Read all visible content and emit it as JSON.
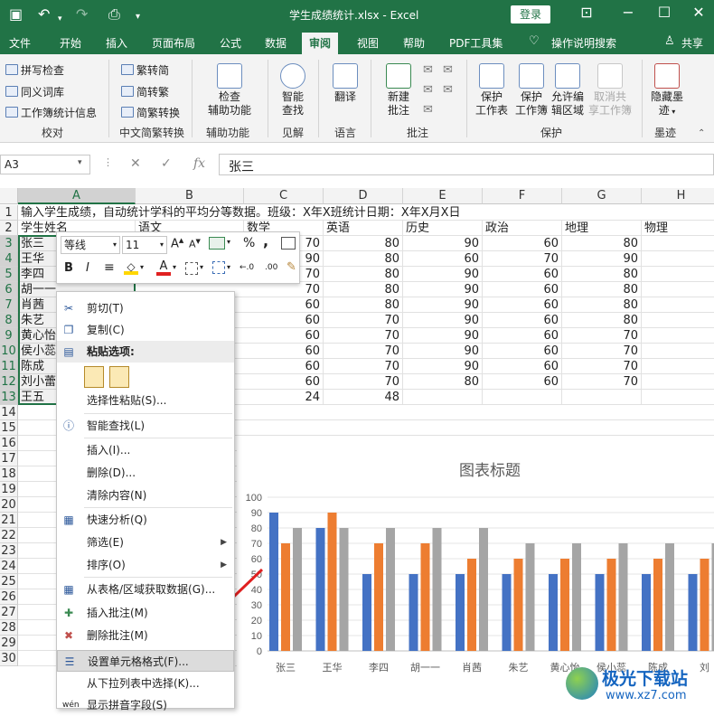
{
  "window": {
    "title": "学生成绩统计.xlsx  -  Excel",
    "login": "登录"
  },
  "menu_tabs": [
    "文件",
    "开始",
    "插入",
    "页面布局",
    "公式",
    "数据",
    "审阅",
    "视图",
    "帮助",
    "PDF工具集",
    "操作说明搜索",
    "共享"
  ],
  "active_tab": "审阅",
  "ribbon": {
    "proofing": {
      "spell": "拼写检查",
      "thesaurus": "同义词库",
      "stats": "工作簿统计信息",
      "group": "校对"
    },
    "chinese": {
      "to_trad": "繁转简",
      "to_simp": "简转繁",
      "convert": "简繁转换",
      "group": "中文简繁转换"
    },
    "access": {
      "check_line1": "检查",
      "check_line2": "辅助功能",
      "group": "辅助功能"
    },
    "insights": {
      "smart_line1": "智能",
      "smart_line2": "查找",
      "group": "见解"
    },
    "language": {
      "translate": "翻译",
      "group": "语言"
    },
    "comments": {
      "new_line1": "新建",
      "new_line2": "批注",
      "group": "批注"
    },
    "protect": {
      "sheet_line1": "保护",
      "sheet_line2": "工作表",
      "book_line1": "保护",
      "book_line2": "工作簿",
      "range_line1": "允许编",
      "range_line2": "辑区域",
      "unshare_line1": "取消共",
      "unshare_line2": "享工作簿",
      "group": "保护"
    },
    "ink": {
      "hide_line1": "隐藏墨",
      "hide_line2": "迹",
      "group": "墨迹"
    }
  },
  "formula_bar": {
    "name_box": "A3",
    "cancel": "✕",
    "enter": "✓",
    "fx": "fx",
    "content": "张三"
  },
  "sheet": {
    "columns": [
      "A",
      "B",
      "C",
      "D",
      "E",
      "F",
      "G",
      "H"
    ],
    "rows": [
      "1",
      "2",
      "3",
      "4",
      "5",
      "6",
      "7",
      "8",
      "9",
      "10",
      "11",
      "12",
      "13",
      "14",
      "15",
      "16",
      "17",
      "18",
      "19",
      "20",
      "21",
      "22",
      "23",
      "24",
      "25",
      "26",
      "27",
      "28",
      "29",
      "30"
    ],
    "row1_text": "输入学生成绩，自动统计学科的平均分等数据。班级：X年X班统计日期：X年X月X日",
    "headers": {
      "a": "学生姓名",
      "b": "语文",
      "c": "数学",
      "d": "英语",
      "e": "历史",
      "f": "政治",
      "g": "地理",
      "h": "物理"
    },
    "names": [
      "张三",
      "王华",
      "李四",
      "胡一一",
      "肖茜",
      "朱艺",
      "黄心怡",
      "侯小蕊",
      "陈成",
      "刘小蕾",
      "王五"
    ],
    "math": [
      "70",
      "90",
      "70",
      "70",
      "60",
      "60",
      "60",
      "60",
      "60",
      "60",
      "24"
    ],
    "english": [
      "80",
      "80",
      "80",
      "80",
      "80",
      "70",
      "70",
      "70",
      "70",
      "70",
      "48"
    ],
    "history": [
      "90",
      "60",
      "90",
      "90",
      "90",
      "90",
      "90",
      "90",
      "90",
      "80",
      ""
    ],
    "politics": [
      "60",
      "70",
      "60",
      "60",
      "60",
      "60",
      "60",
      "60",
      "60",
      "60",
      ""
    ],
    "geography": [
      "80",
      "90",
      "80",
      "80",
      "80",
      "80",
      "70",
      "70",
      "70",
      "70",
      ""
    ]
  },
  "mini_toolbar": {
    "font": "等线",
    "size": "11",
    "grow": "A",
    "shrink": "A",
    "percent": "%",
    "comma": ",",
    "bold": "B",
    "italic": "I",
    "font_color_letter": "A",
    "dec_inc": "←.0",
    "dec_dec": ".00"
  },
  "context_menu": {
    "cut": "剪切(T)",
    "copy": "复制(C)",
    "paste_options": "粘贴选项:",
    "paste_special": "选择性粘贴(S)...",
    "smart_lookup": "智能查找(L)",
    "insert": "插入(I)...",
    "delete": "删除(D)...",
    "clear": "清除内容(N)",
    "quick_analysis": "快速分析(Q)",
    "filter": "筛选(E)",
    "sort": "排序(O)",
    "from_table": "从表格/区域获取数据(G)...",
    "insert_comment": "插入批注(M)",
    "delete_comment": "删除批注(M)",
    "format_cells": "设置单元格格式(F)...",
    "pick_list": "从下拉列表中选择(K)...",
    "phonetic": "显示拼音字段(S)",
    "phonetic_icon": "wén"
  },
  "chart_data": {
    "type": "bar",
    "title": "图表标题",
    "categories": [
      "张三",
      "王华",
      "李四",
      "胡一一",
      "肖茜",
      "朱艺",
      "黄心怡",
      "侯小蕊",
      "陈成",
      "刘"
    ],
    "ylim": [
      0,
      100
    ],
    "yticks": [
      "0",
      "10",
      "20",
      "30",
      "40",
      "50",
      "60",
      "70",
      "80",
      "90",
      "100"
    ],
    "series": [
      {
        "values": [
          90,
          80,
          50,
          50,
          50,
          50,
          50,
          50,
          50,
          50
        ],
        "color": "#4472c4"
      },
      {
        "values": [
          70,
          90,
          70,
          70,
          60,
          60,
          60,
          60,
          60,
          60
        ],
        "color": "#ed7d31"
      },
      {
        "values": [
          80,
          80,
          80,
          80,
          80,
          70,
          70,
          70,
          70,
          70
        ],
        "color": "#a5a5a5"
      }
    ]
  },
  "watermark": {
    "brand": "极光下载站",
    "url": "www.xz7.com"
  }
}
